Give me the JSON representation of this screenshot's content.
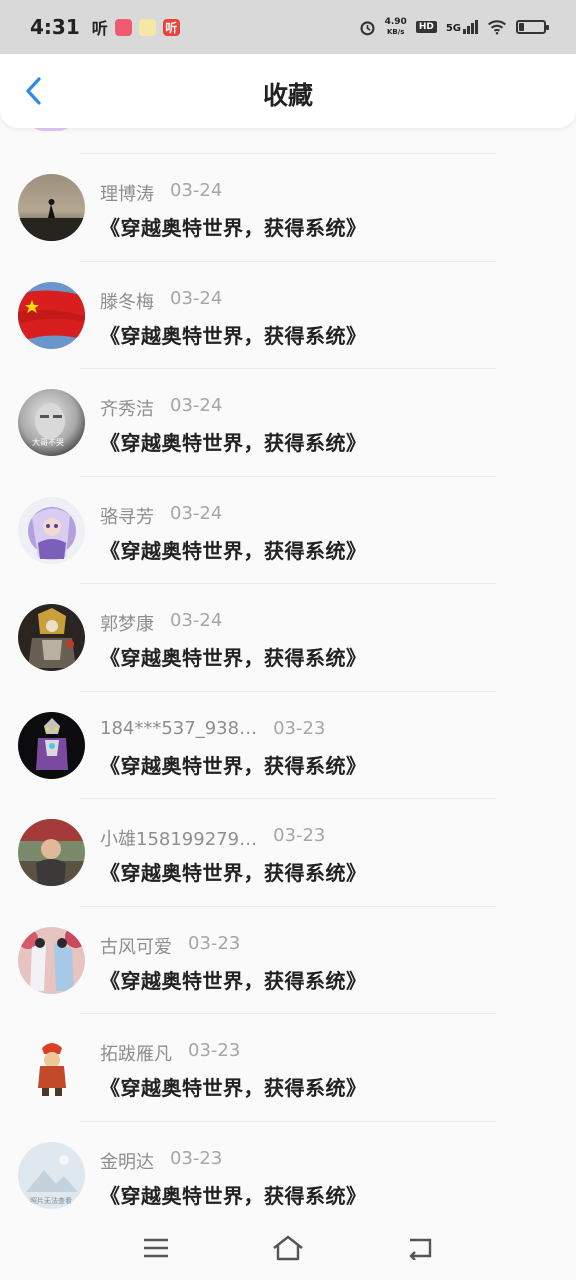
{
  "status_bar": {
    "time": "4:31",
    "app_icons": [
      "听",
      "",
      "",
      "听"
    ],
    "net_speed_value": "4.90",
    "net_speed_unit": "KB/s",
    "hd": "HD",
    "signal": "5G",
    "battery_level": 0.2
  },
  "header": {
    "title": "收藏"
  },
  "items": [
    {
      "name": "理博涛",
      "date": "03-24",
      "title": "《穿越奥特世界，获得系统》"
    },
    {
      "name": "滕冬梅",
      "date": "03-24",
      "title": "《穿越奥特世界，获得系统》"
    },
    {
      "name": "齐秀洁",
      "date": "03-24",
      "title": "《穿越奥特世界，获得系统》"
    },
    {
      "name": "骆寻芳",
      "date": "03-24",
      "title": "《穿越奥特世界，获得系统》"
    },
    {
      "name": "郭梦康",
      "date": "03-24",
      "title": "《穿越奥特世界，获得系统》"
    },
    {
      "name": "184***537_938…",
      "date": "03-23",
      "title": "《穿越奥特世界，获得系统》"
    },
    {
      "name": "小雄158199279…",
      "date": "03-23",
      "title": "《穿越奥特世界，获得系统》"
    },
    {
      "name": "古风可爱",
      "date": "03-23",
      "title": "《穿越奥特世界，获得系统》"
    },
    {
      "name": "拓跋雁凡",
      "date": "03-23",
      "title": "《穿越奥特世界，获得系统》"
    },
    {
      "name": "金明达",
      "date": "03-23",
      "title": "《穿越奥特世界，获得系统》"
    }
  ],
  "avatar_caption_3": "大哥不哭",
  "avatar_caption_10": "照片无法查看",
  "colors": {
    "accent": "#2e8ae6",
    "title": "#222222",
    "meta": "#8e8e8e"
  }
}
